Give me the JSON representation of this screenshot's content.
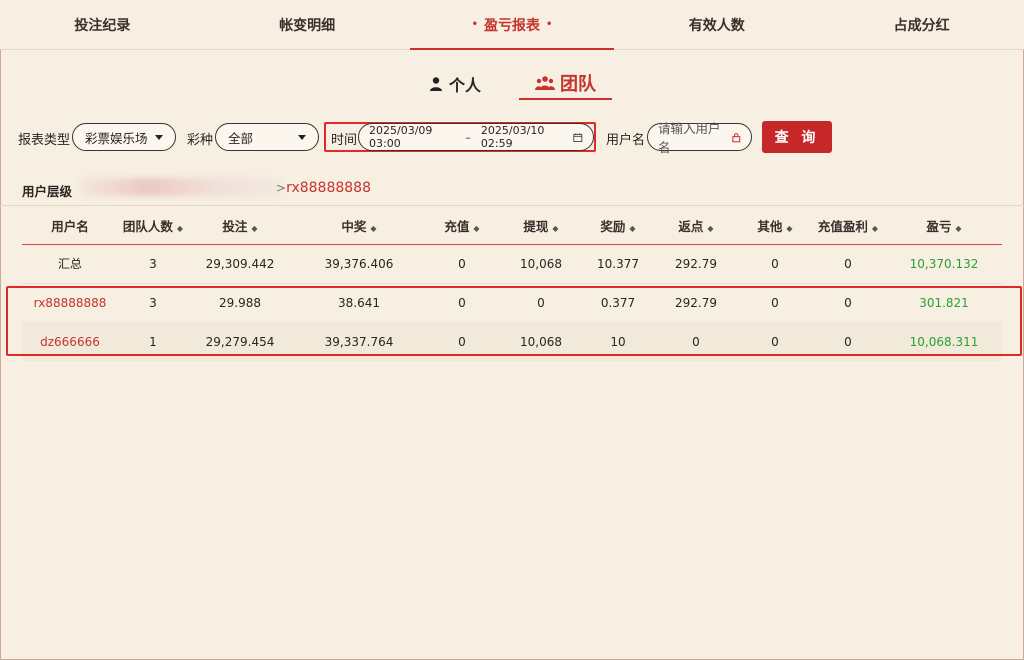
{
  "tabs": [
    {
      "label": "投注纪录"
    },
    {
      "label": "帐变明细"
    },
    {
      "label": "盈亏报表",
      "active": true
    },
    {
      "label": "有效人数"
    },
    {
      "label": "占成分红"
    }
  ],
  "subtabs": {
    "personal": "个人",
    "team": "团队"
  },
  "filters": {
    "report_type_label": "报表类型",
    "report_type_value": "彩票娱乐场",
    "lottery_label": "彩种",
    "lottery_value": "全部",
    "time_label": "时间",
    "time_start": "2025/03/09 03:00",
    "time_sep": "–",
    "time_end": "2025/03/10 02:59",
    "username_label": "用户名",
    "username_placeholder": "请输入用户名",
    "query_button": "查 询"
  },
  "user_level": {
    "label": "用户层级",
    "path_sep": ">",
    "path_current": "rx88888888"
  },
  "table": {
    "headers": [
      "用户名",
      "团队人数",
      "投注",
      "中奖",
      "充值",
      "提现",
      "奖励",
      "返点",
      "其他",
      "充值盈利",
      "盈亏"
    ],
    "rows": [
      [
        "汇总",
        "3",
        "29,309.442",
        "39,376.406",
        "0",
        "10,068",
        "10.377",
        "292.79",
        "0",
        "0",
        "10,370.132"
      ],
      [
        "rx88888888",
        "3",
        "29.988",
        "38.641",
        "0",
        "0",
        "0.377",
        "292.79",
        "0",
        "0",
        "301.821"
      ],
      [
        "dz666666",
        "1",
        "29,279.454",
        "39,337.764",
        "0",
        "10,068",
        "10",
        "0",
        "0",
        "0",
        "10,068.311"
      ]
    ]
  },
  "colors": {
    "accent": "#c6332c",
    "profit_green": "#2aa233",
    "background": "#f6efe2"
  }
}
